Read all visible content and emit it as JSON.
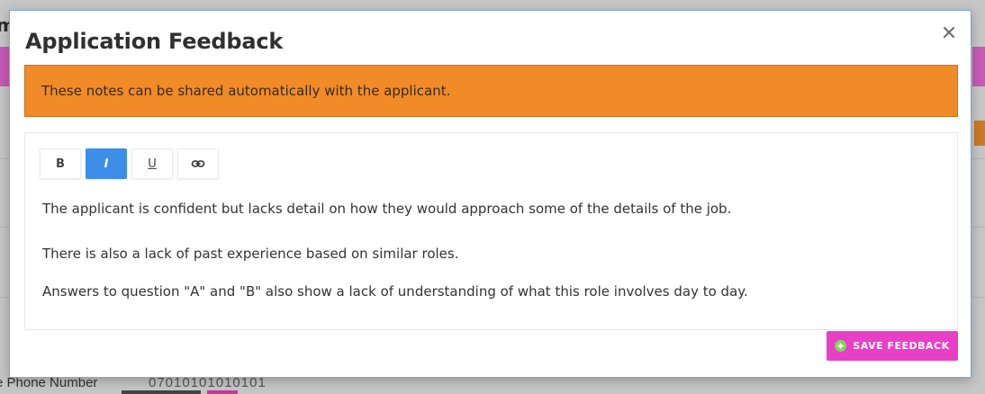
{
  "background_page": {
    "title_fragment": "m",
    "row_label": "bile Phone Number",
    "row_value": "07010101010101"
  },
  "modal": {
    "title": "Application Feedback",
    "close_icon": "close-icon",
    "alert_text": "These notes can be shared automatically with the applicant.",
    "toolbar": {
      "bold": "B",
      "italic": "I",
      "underline": "U",
      "link_icon": "link-icon",
      "active": "italic"
    },
    "content": [
      "The applicant is confident but lacks detail on how they would approach some of the details of the job.",
      "There is also a lack of past experience based on similar roles.",
      "Answers to question \"A\" and \"B\" also show a lack of understanding of what this role involves day to day."
    ],
    "save_button": {
      "label": "SAVE FEEDBACK",
      "icon": "plus-circle-icon"
    }
  },
  "colors": {
    "alert_bg": "#f08b28",
    "active_toolbar": "#3d8ee8",
    "save_button": "#e93fc6",
    "save_icon": "#7ed957"
  }
}
